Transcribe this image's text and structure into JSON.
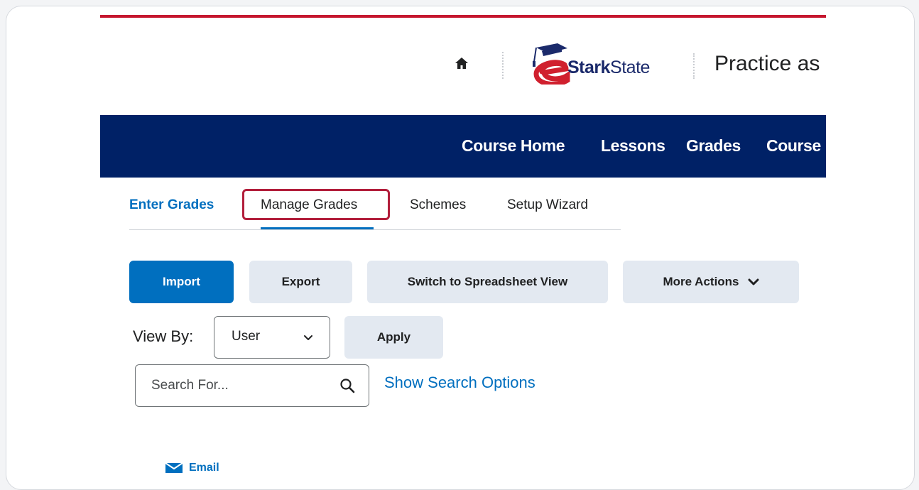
{
  "header": {
    "logo": {
      "prefix": "Stark",
      "suffix": "State"
    },
    "course_title": "Practice as"
  },
  "nav": {
    "items": [
      "Course Home",
      "Lessons",
      "Grades",
      "Course"
    ]
  },
  "tabs": {
    "items": [
      "Enter Grades",
      "Manage Grades",
      "Schemes",
      "Setup Wizard"
    ]
  },
  "actions": {
    "import": "Import",
    "export": "Export",
    "spreadsheet": "Switch to Spreadsheet View",
    "more": "More Actions"
  },
  "view_by": {
    "label": "View By:",
    "selected": "User",
    "apply": "Apply"
  },
  "search": {
    "placeholder": "Search For...",
    "options_link": "Show Search Options"
  },
  "email": {
    "label": "Email"
  },
  "colors": {
    "accent_red": "#c5162e",
    "nav_blue": "#002166",
    "link_blue": "#006fbf",
    "highlight": "#b21e3b"
  }
}
